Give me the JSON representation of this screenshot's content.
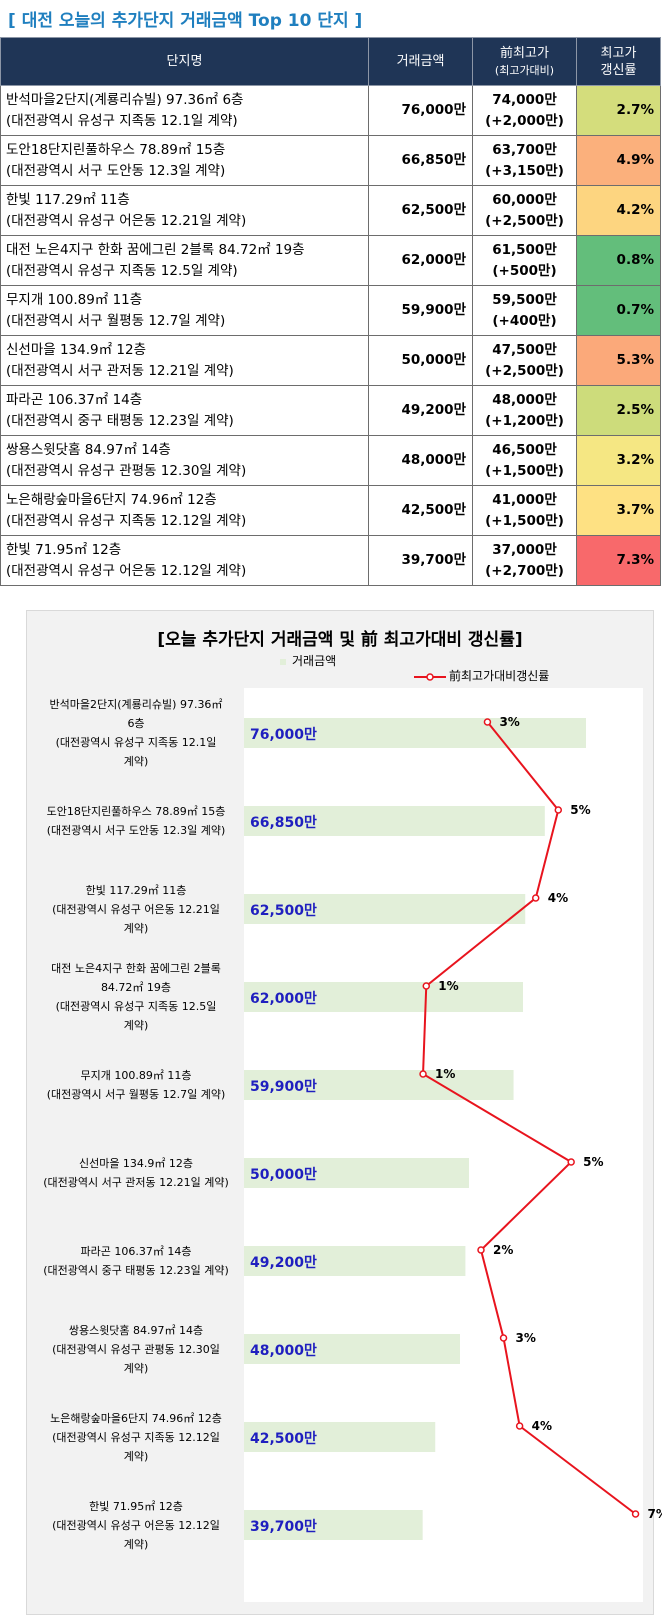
{
  "page_title": "[ 대전 오늘의 추가단지 거래금액 Top 10 단지 ]",
  "table": {
    "headers": {
      "name": "단지명",
      "amount": "거래금액",
      "prev_main": "前최고가",
      "prev_sub": "(최고가대비)",
      "rate_line1": "최고가",
      "rate_line2": "갱신률"
    },
    "rows": [
      {
        "line1": "반석마을2단지(계룡리슈빌) 97.36㎡ 6층",
        "line2": "(대전광역시 유성구 지족동 12.1일 계약)",
        "amount": "76,000만",
        "prev": "74,000만",
        "diff": "(+2,000만)",
        "rate": "2.7%",
        "color": "#d4dd7c"
      },
      {
        "line1": "도안18단지린풀하우스 78.89㎡ 15층",
        "line2": "(대전광역시 서구 도안동 12.3일 계약)",
        "amount": "66,850만",
        "prev": "63,700만",
        "diff": "(+3,150만)",
        "rate": "4.9%",
        "color": "#fbb07c"
      },
      {
        "line1": "한빛 117.29㎡ 11층",
        "line2": "(대전광역시 유성구 어은동 12.21일 계약)",
        "amount": "62,500만",
        "prev": "60,000만",
        "diff": "(+2,500만)",
        "rate": "4.2%",
        "color": "#fdd580"
      },
      {
        "line1": "대전 노은4지구 한화 꿈에그린 2블록 84.72㎡ 19층",
        "line2": "(대전광역시 유성구 지족동 12.5일 계약)",
        "amount": "62,000만",
        "prev": "61,500만",
        "diff": "(+500만)",
        "rate": "0.8%",
        "color": "#63be7b"
      },
      {
        "line1": "무지개 100.89㎡ 11층",
        "line2": "(대전광역시 서구 월평동 12.7일 계약)",
        "amount": "59,900만",
        "prev": "59,500만",
        "diff": "(+400만)",
        "rate": "0.7%",
        "color": "#63be7b"
      },
      {
        "line1": "신선마을 134.9㎡ 12층",
        "line2": "(대전광역시 서구 관저동 12.21일 계약)",
        "amount": "50,000만",
        "prev": "47,500만",
        "diff": "(+2,500만)",
        "rate": "5.3%",
        "color": "#fba97a"
      },
      {
        "line1": "파라곤 106.37㎡ 14층",
        "line2": "(대전광역시 중구 태평동 12.23일 계약)",
        "amount": "49,200만",
        "prev": "48,000만",
        "diff": "(+1,200만)",
        "rate": "2.5%",
        "color": "#cddc7b"
      },
      {
        "line1": "쌍용스윗닷홈 84.97㎡ 14층",
        "line2": "(대전광역시 유성구 관평동 12.30일 계약)",
        "amount": "48,000만",
        "prev": "46,500만",
        "diff": "(+1,500만)",
        "rate": "3.2%",
        "color": "#f5e783"
      },
      {
        "line1": "노은해랑숲마을6단지 74.96㎡ 12층",
        "line2": "(대전광역시 유성구 지족동 12.12일 계약)",
        "amount": "42,500만",
        "prev": "41,000만",
        "diff": "(+1,500만)",
        "rate": "3.7%",
        "color": "#fee183"
      },
      {
        "line1": "한빛 71.95㎡ 12층",
        "line2": "(대전광역시 유성구 어은동 12.12일 계약)",
        "amount": "39,700만",
        "prev": "37,000만",
        "diff": "(+2,700만)",
        "rate": "7.3%",
        "color": "#f8696b"
      }
    ]
  },
  "chart_data": {
    "type": "bar",
    "title": "[오늘 추가단지 거래금액  및 前 최고가대비 갱신률]",
    "orientation": "horizontal",
    "categories": [
      [
        "반석마을2단지(계룡리슈빌) 97.36㎡",
        "6층",
        "(대전광역시 유성구 지족동 12.1일",
        "계약)"
      ],
      [
        "도안18단지린풀하우스 78.89㎡ 15층",
        "(대전광역시 서구 도안동 12.3일 계약)"
      ],
      [
        "한빛 117.29㎡ 11층",
        "(대전광역시 유성구 어은동 12.21일",
        "계약)"
      ],
      [
        "대전 노은4지구 한화 꿈에그린 2블록",
        "84.72㎡ 19층",
        "(대전광역시 유성구 지족동 12.5일",
        "계약)"
      ],
      [
        "무지개 100.89㎡ 11층",
        "(대전광역시 서구 월평동 12.7일 계약)"
      ],
      [
        "신선마을 134.9㎡ 12층",
        "(대전광역시 서구 관저동 12.21일 계약)"
      ],
      [
        "파라곤 106.37㎡ 14층",
        "(대전광역시 중구 태평동 12.23일 계약)"
      ],
      [
        "쌍용스윗닷홈 84.97㎡ 14층",
        "(대전광역시 유성구 관평동 12.30일",
        "계약)"
      ],
      [
        "노은해랑숲마을6단지 74.96㎡ 12층",
        "(대전광역시 유성구 지족동 12.12일",
        "계약)"
      ],
      [
        "한빛 71.95㎡ 12층",
        "(대전광역시 유성구 어은동 12.12일",
        "계약)"
      ]
    ],
    "series": [
      {
        "name": "거래금액",
        "kind": "bar",
        "color": "#e2efd9",
        "values": [
          76000,
          66850,
          62500,
          62000,
          59900,
          50000,
          49200,
          48000,
          42500,
          39700
        ],
        "labels": [
          "76,000만",
          "66,850만",
          "62,500만",
          "62,000만",
          "59,900만",
          "50,000만",
          "49,200만",
          "48,000만",
          "42,500만",
          "39,700만"
        ]
      },
      {
        "name": "前최고가대비갱신률",
        "kind": "line",
        "color": "#e8141e",
        "values": [
          2.7,
          4.9,
          4.2,
          0.8,
          0.7,
          5.3,
          2.5,
          3.2,
          3.7,
          7.3
        ],
        "labels": [
          "3%",
          "5%",
          "4%",
          "1%",
          "1%",
          "5%",
          "2%",
          "3%",
          "4%",
          "7%"
        ]
      }
    ],
    "bar_xlim": [
      0,
      80000
    ],
    "line_xlim": [
      -8,
      8
    ],
    "bar_label_color": "#1f1fbf",
    "grid": false,
    "legend": "top"
  }
}
